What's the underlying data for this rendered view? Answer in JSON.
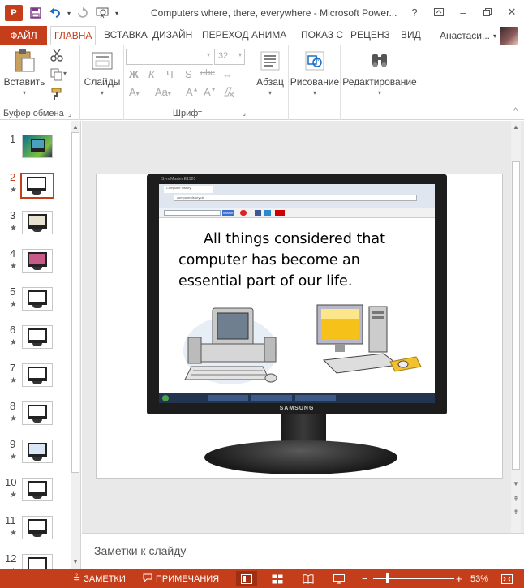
{
  "window": {
    "title": "Computers where, there, everywhere - Microsoft Power...",
    "controls": [
      "?",
      "restore",
      "minimize",
      "maximize",
      "close"
    ]
  },
  "tabs": [
    {
      "label": "ФАЙЛ"
    },
    {
      "label": "ГЛАВНА"
    },
    {
      "label": "ВСТАВКА"
    },
    {
      "label": "ДИЗАЙН"
    },
    {
      "label": "ПЕРЕХОД"
    },
    {
      "label": "АНИМА"
    },
    {
      "label": "ПОКАЗ С"
    },
    {
      "label": "РЕЦЕНЗ"
    },
    {
      "label": "ВИД"
    }
  ],
  "user": {
    "name": "Анастаси..."
  },
  "ribbon": {
    "paste_label": "Вставить",
    "slides_label": "Слайды",
    "font_size": "32",
    "paragraph_label": "Абзац",
    "drawing_label": "Рисование",
    "editing_label": "Редактирование",
    "group_clipboard": "Буфер обмена",
    "group_font": "Шрифт",
    "bold": "Ж",
    "italic": "К",
    "underline": "Ч",
    "strike": "S",
    "abc": "abc",
    "case": "Aa"
  },
  "thumbnails": [
    {
      "num": "1",
      "star": ""
    },
    {
      "num": "2",
      "star": "★"
    },
    {
      "num": "3",
      "star": "★"
    },
    {
      "num": "4",
      "star": "★"
    },
    {
      "num": "5",
      "star": "★"
    },
    {
      "num": "6",
      "star": "★"
    },
    {
      "num": "7",
      "star": "★"
    },
    {
      "num": "8",
      "star": "★"
    },
    {
      "num": "9",
      "star": "★"
    },
    {
      "num": "10",
      "star": "★"
    },
    {
      "num": "11",
      "star": "★"
    },
    {
      "num": "12",
      "star": "★"
    }
  ],
  "slide": {
    "text": "All things considered that computer has become an essential part of our life.",
    "monitor_brand": "SAMSUNG",
    "monitor_model": "SyncMaster E1920",
    "browser_tab": "Computer history",
    "browser_url": "computerhistory.uk",
    "search_label": "Search"
  },
  "notes": {
    "placeholder": "Заметки к слайду"
  },
  "status": {
    "notes_label": "ЗАМЕТКИ",
    "comments_label": "ПРИМЕЧАНИЯ",
    "zoom": "53%"
  },
  "colors": {
    "accent": "#c43e1c",
    "accent_dark": "#9e2f12"
  }
}
